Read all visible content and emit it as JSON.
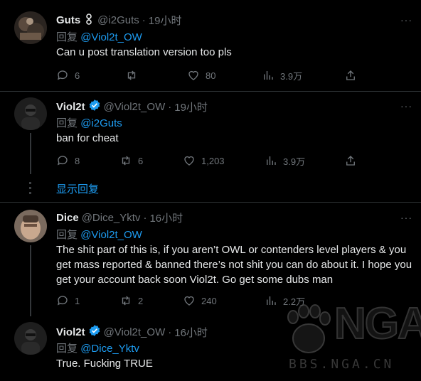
{
  "tweets": [
    {
      "name": "Guts",
      "name_badge": "link-icon",
      "handle": "@i2Guts",
      "time": "19小时",
      "reply_prefix": "回复",
      "reply_to": "@Viol2t_OW",
      "text": "Can u post translation version too pls",
      "stats": {
        "replies": "6",
        "retweets": "",
        "likes": "80",
        "views": "3.9万"
      }
    },
    {
      "name": "Viol2t",
      "verified": true,
      "handle": "@Viol2t_OW",
      "time": "19小时",
      "reply_prefix": "回复",
      "reply_to": "@i2Guts",
      "text": "ban for cheat",
      "stats": {
        "replies": "8",
        "retweets": "6",
        "likes": "1,203",
        "views": "3.9万"
      }
    },
    {
      "name": "Dice",
      "handle": "@Dice_Yktv",
      "time": "16小时",
      "reply_prefix": "回复",
      "reply_to": "@Viol2t_OW",
      "text": "The shit part of this is, if you aren’t OWL or contenders level players & you get mass reported & banned there’s not shit you can do about it. I hope you get your account back soon Viol2t. Go get some dubs man",
      "stats": {
        "replies": "1",
        "retweets": "2",
        "likes": "240",
        "views": "2.2万"
      }
    },
    {
      "name": "Viol2t",
      "verified": true,
      "handle": "@Viol2t_OW",
      "time": "16小时",
      "reply_prefix": "回复",
      "reply_to": "@Dice_Yktv",
      "text": "True. Fucking TRUE"
    }
  ],
  "show_replies": "显示回复",
  "separator": "·",
  "more_glyph": "···",
  "watermark": {
    "logo": "NGA",
    "url": "BBS.NGA.CN"
  },
  "colors": {
    "accent": "#1d9bf0",
    "muted": "#71767b",
    "text": "#e7e9ea",
    "background": "#000000"
  }
}
